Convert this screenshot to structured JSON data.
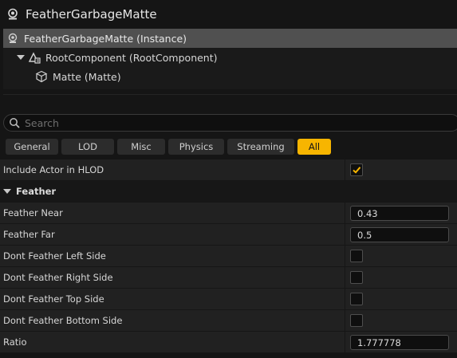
{
  "window": {
    "title": "FeatherGarbageMatte",
    "icon": "actor-sphere-icon"
  },
  "component_tree": {
    "items": [
      {
        "label": "FeatherGarbageMatte (Instance)",
        "selected": true,
        "icon": "actor-instance-icon"
      },
      {
        "label": "RootComponent (RootComponent)",
        "expanded": true,
        "icon": "root-component-icon"
      },
      {
        "label": "Matte (Matte)",
        "icon": "component-cube-icon"
      }
    ]
  },
  "search": {
    "placeholder": "Search",
    "value": ""
  },
  "filter_tabs": [
    {
      "label": "General",
      "active": false
    },
    {
      "label": "LOD",
      "active": false
    },
    {
      "label": "Misc",
      "active": false
    },
    {
      "label": "Physics",
      "active": false
    },
    {
      "label": "Streaming",
      "active": false
    },
    {
      "label": "All",
      "active": true
    }
  ],
  "properties": {
    "include_actor_in_hlod": {
      "label": "Include Actor in HLOD",
      "checked": true
    },
    "feather_category": {
      "label": "Feather",
      "expanded": true
    },
    "feather_near": {
      "label": "Feather Near",
      "value": "0.43"
    },
    "feather_far": {
      "label": "Feather Far",
      "value": "0.5"
    },
    "dont_feather_left": {
      "label": "Dont Feather Left Side",
      "checked": false
    },
    "dont_feather_right": {
      "label": "Dont Feather Right Side",
      "checked": false
    },
    "dont_feather_top": {
      "label": "Dont Feather Top Side",
      "checked": false
    },
    "dont_feather_bottom": {
      "label": "Dont Feather Bottom Side",
      "checked": false
    },
    "ratio": {
      "label": "Ratio",
      "value": "1.777778"
    }
  },
  "colors": {
    "accent": "#f7b500",
    "background": "#151515",
    "row": "#212121",
    "selected_row": "#505050"
  }
}
